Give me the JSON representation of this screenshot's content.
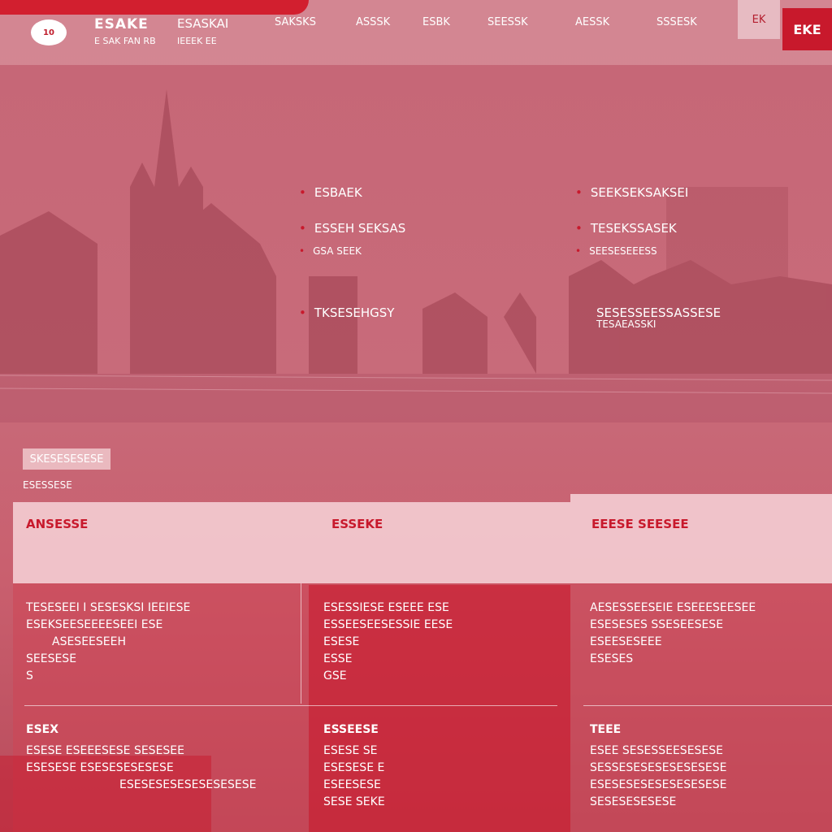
{
  "header": {
    "logo_text": "10",
    "brand_title": "ESAKE",
    "brand_subtitle": "E SAK FAN RB",
    "sub_title": "ESASKAI",
    "sub_subtitle": "IEEEK EE",
    "nav": [
      "SAKSKS",
      "ASSSK",
      "ESBK",
      "SEESSK",
      "AESSK",
      "SSSESK"
    ],
    "lang_label": "EK",
    "login_label": "EKE"
  },
  "highlights": {
    "left": [
      "ESBAEK",
      "ESSEH SEKSAS",
      "GSA SEEK",
      "TKSESEHGSY"
    ],
    "right": [
      "SEEKSEKSAKSEI",
      "TESEKSSASEK",
      "SEESESEEESS",
      "SESESSEESSASSESE",
      "TESAEASSKI"
    ]
  },
  "section": {
    "badge": "SKESESESESE",
    "badge_sub": "ESESSESE"
  },
  "cards": {
    "c1_title": "ANSESSE",
    "c2_title": "ESSEKE",
    "c3_title": "EEESE SEESEE",
    "c1_lines": [
      "TESESEEI I SESESKSI IEEIESE",
      "ESEKSEESEEEESEEI ESE",
      "ASESEESEEH",
      "SEESESE",
      "S"
    ],
    "c2_lines": [
      "ESESSIESE ESEEE ESE",
      "ESSEESEESESSIE EESE",
      "ESESE",
      "ESSE",
      "GSE"
    ],
    "c3_lines": [
      "AESESSEESEIE ESEEESEESEE",
      "ESESESES SSESEESESE",
      "ESEESESEEE",
      "ESESES"
    ],
    "c4_title": "ESEX",
    "c5_title": "ESSEESE",
    "c6_title": "TEEE",
    "c4_lines": [
      "ESESE ESEEESESE SESESEE",
      "ESESESE ESESESESESESE",
      "ESESESESESESESESESE"
    ],
    "c5_lines": [
      "ESESE SE",
      "ESESESE E",
      "ESEESESE",
      "SESE SEKE"
    ],
    "c6_lines": [
      "ESEE SESESSEESESESE",
      "SESSESESESESESESESE",
      "ESESESESESESESESESE",
      "SESESESESESE"
    ]
  }
}
